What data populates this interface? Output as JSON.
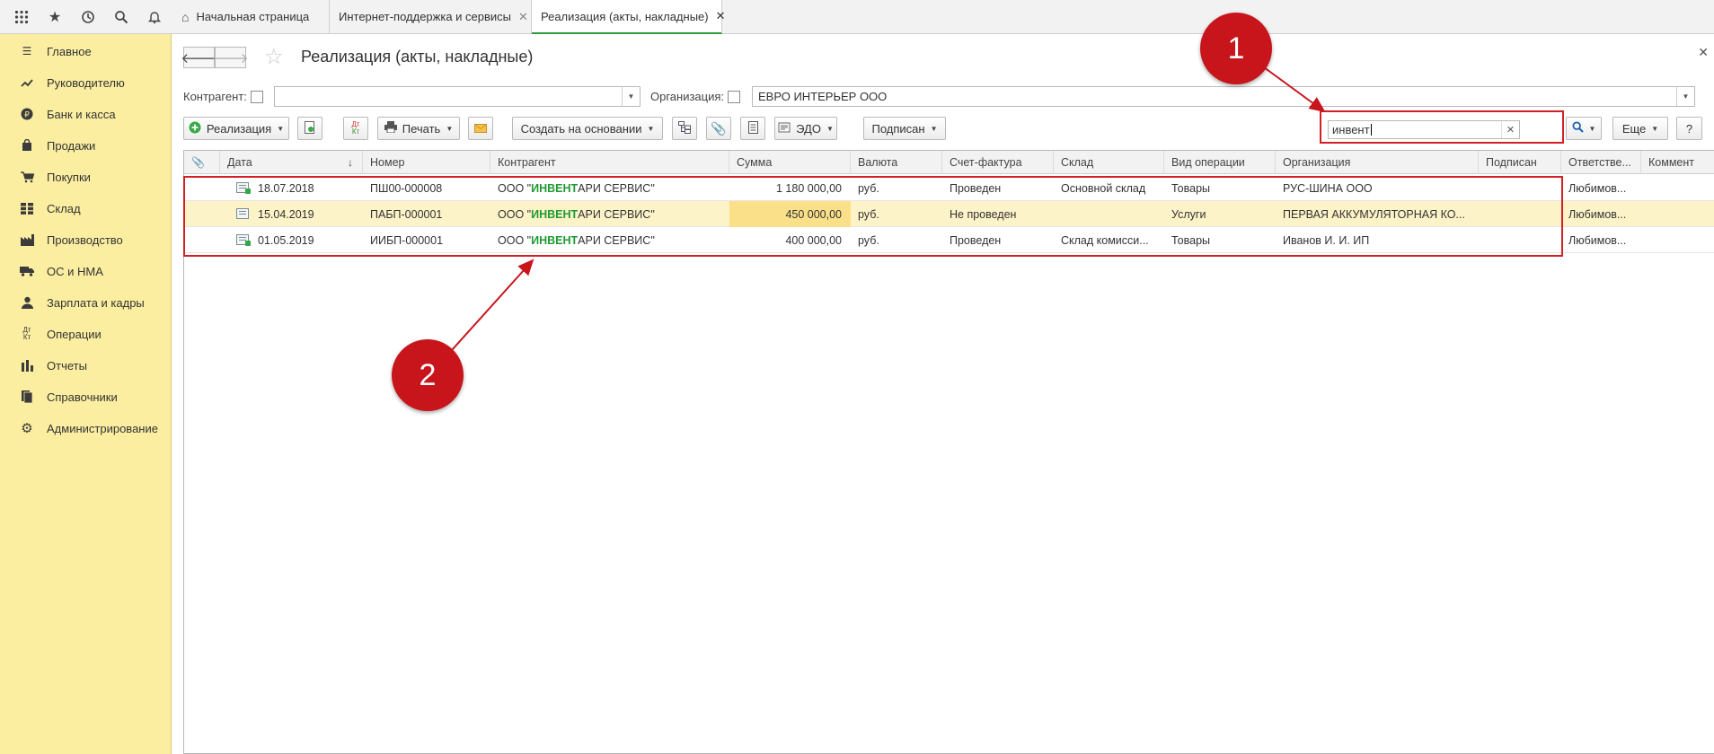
{
  "topbar": {
    "icons": [
      "apps-grid-icon",
      "star-icon",
      "history-icon",
      "search-icon",
      "bell-icon"
    ],
    "tabs": [
      {
        "label": "Начальная страница",
        "icon": "home-icon"
      },
      {
        "label": "Интернет-поддержка и сервисы"
      },
      {
        "label": "Реализация (акты, накладные)"
      }
    ]
  },
  "sidebar": {
    "items": [
      {
        "label": "Главное",
        "icon": "menu-lines-icon"
      },
      {
        "label": "Руководителю",
        "icon": "trend-icon"
      },
      {
        "label": "Банк и касса",
        "icon": "ruble-coin-icon"
      },
      {
        "label": "Продажи",
        "icon": "shopping-bag-icon"
      },
      {
        "label": "Покупки",
        "icon": "cart-icon"
      },
      {
        "label": "Склад",
        "icon": "warehouse-icon"
      },
      {
        "label": "Производство",
        "icon": "factory-icon"
      },
      {
        "label": "ОС и НМА",
        "icon": "truck-icon"
      },
      {
        "label": "Зарплата и кадры",
        "icon": "person-icon"
      },
      {
        "label": "Операции",
        "icon": "dt-kt-icon"
      },
      {
        "label": "Отчеты",
        "icon": "bar-chart-icon"
      },
      {
        "label": "Справочники",
        "icon": "books-icon"
      },
      {
        "label": "Администрирование",
        "icon": "gear-icon"
      }
    ]
  },
  "form": {
    "title": "Реализация (акты, накладные)",
    "filters": {
      "counterparty_label": "Контрагент:",
      "counterparty_value": "",
      "organization_label": "Организация:",
      "organization_value": "ЕВРО ИНТЕРЬЕР ООО"
    },
    "toolbar": {
      "create_label": "Реализация",
      "print_label": "Печать",
      "create_based_label": "Создать на основании",
      "edo_label": "ЭДО",
      "signed_label": "Подписан",
      "more_label": "Еще",
      "help_label": "?"
    },
    "search": {
      "value": "инвент"
    }
  },
  "table": {
    "columns": [
      "Дата",
      "Номер",
      "Контрагент",
      "Сумма",
      "Валюта",
      "Счет-фактура",
      "Склад",
      "Вид операции",
      "Организация",
      "Подписан",
      "Ответстве...",
      "Коммент"
    ],
    "rows": [
      {
        "date": "18.07.2018",
        "number": "ПШ00-000008",
        "cp_pre": "ООО \"",
        "cp_hl": "ИНВЕНТ",
        "cp_post": "АРИ СЕРВИС\"",
        "sum": "1 180 000,00",
        "currency": "руб.",
        "invoice": "Проведен",
        "warehouse": "Основной склад",
        "operation": "Товары",
        "organization": "РУС-ШИНА ООО",
        "signed": "",
        "responsible": "Любимов...",
        "comment": ""
      },
      {
        "date": "15.04.2019",
        "number": "ПАБП-000001",
        "cp_pre": "ООО \"",
        "cp_hl": "ИНВЕНТ",
        "cp_post": "АРИ СЕРВИС\"",
        "sum": "450 000,00",
        "currency": "руб.",
        "invoice": "Не проведен",
        "warehouse": "",
        "operation": "Услуги",
        "organization": "ПЕРВАЯ АККУМУЛЯТОРНАЯ КО...",
        "signed": "",
        "responsible": "Любимов...",
        "comment": ""
      },
      {
        "date": "01.05.2019",
        "number": "ИИБП-000001",
        "cp_pre": "ООО \"",
        "cp_hl": "ИНВЕНТ",
        "cp_post": "АРИ СЕРВИС\"",
        "sum": "400 000,00",
        "currency": "руб.",
        "invoice": "Проведен",
        "warehouse": "Склад комисси...",
        "operation": "Товары",
        "organization": "Иванов И. И. ИП",
        "signed": "",
        "responsible": "Любимов...",
        "comment": ""
      }
    ]
  },
  "annotations": {
    "marker1": "1",
    "marker2": "2",
    "color": "#d21f26"
  }
}
